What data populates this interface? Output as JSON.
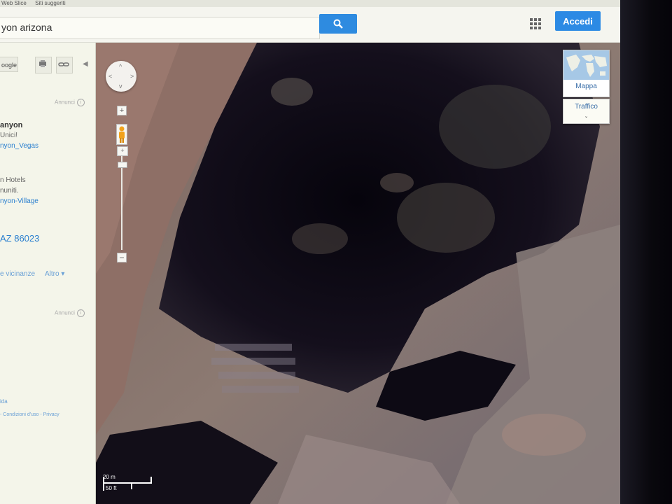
{
  "bookmarks": [
    "Web Slice",
    "Siti suggeriti"
  ],
  "search": {
    "value": "yon arizona"
  },
  "header": {
    "signin_label": "Accedi"
  },
  "panel": {
    "google_button": "oogle",
    "ad_label_1": "Annunci",
    "ad_label_2": "Annunci",
    "info_glyph": "i",
    "results": [
      {
        "title": "anyon",
        "line": "Unici!",
        "link": "nyon_Vegas"
      },
      {
        "title": "",
        "line1": "n Hotels",
        "line2": "nuniti.",
        "link": "nyon-Village"
      }
    ],
    "address": "AZ 86023",
    "nearby": "e vicinanze",
    "more": "Altro ▾",
    "footer_a": "ida",
    "footer_b": "- Condizioni d'uso - Privacy"
  },
  "map": {
    "pan_up": "^",
    "pan_down": "v",
    "pan_left": "<",
    "pan_right": ">",
    "zoom_in": "+",
    "zoom_plus2": "+",
    "zoom_out": "−",
    "map_type_label": "Mappa",
    "traffic_label": "Traffico",
    "traffic_chevron": "⌄",
    "scale_top": "20 m",
    "scale_bottom": "50 ft"
  },
  "colors": {
    "accent_blue": "#2c8ae4",
    "link_blue": "#2a7fcf"
  }
}
